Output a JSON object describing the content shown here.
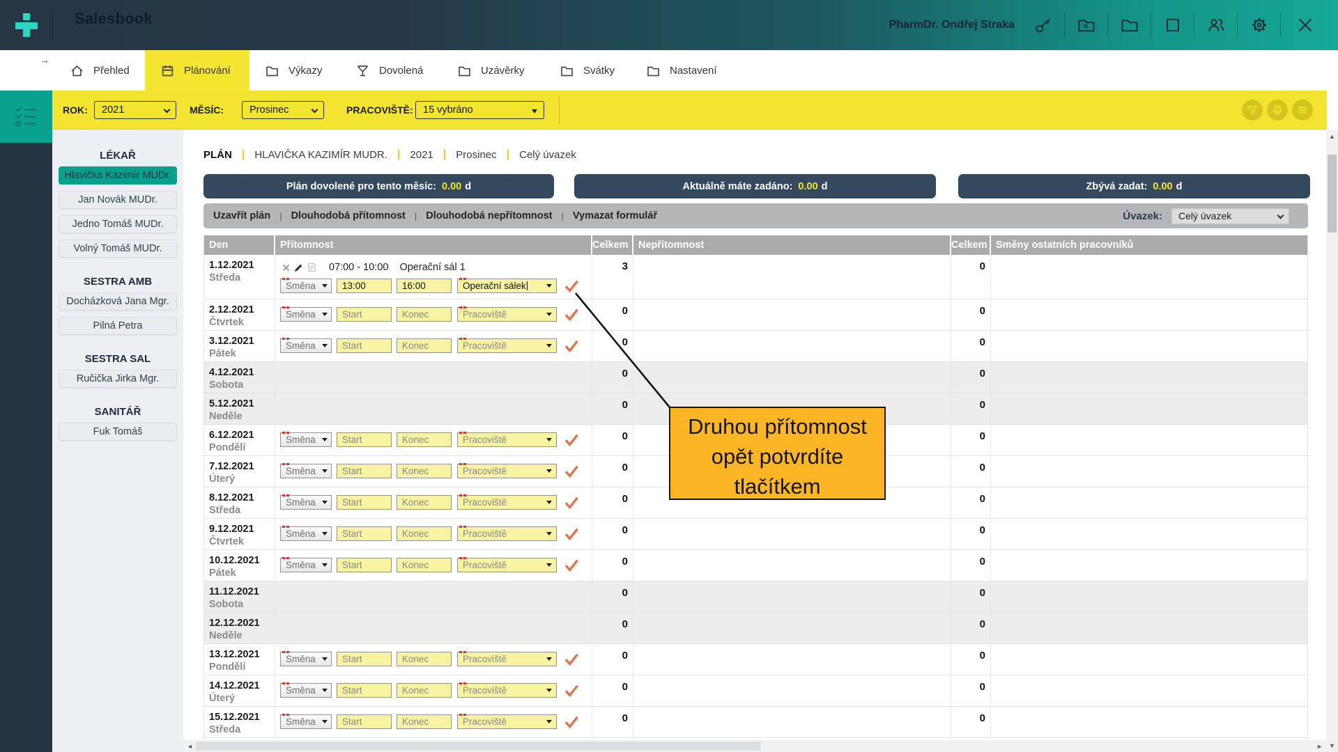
{
  "colors": {
    "brand_teal": "#0AA28E",
    "header_navy": "#273645",
    "header_teal": "#17A897",
    "accent_yellow": "#F3E42F",
    "pill_navy": "#35495E",
    "pill_value_yellow": "#F7E327",
    "check_orange": "#DF744A",
    "callout_amber": "#FBB525",
    "field_yellow": "#F8F2A3",
    "required_red": "#E33528"
  },
  "header": {
    "app_title": "Salesbook",
    "user_name": "PharmDr. Ondřej Straka",
    "icons": [
      "key-icon",
      "folder-n-icon",
      "folder-icon",
      "window-restore-icon",
      "users-icon",
      "gear-icon",
      "close-icon"
    ]
  },
  "nav": {
    "back_arrow": "→",
    "tabs": [
      {
        "label": "Přehled",
        "icon": "home-icon",
        "active": false
      },
      {
        "label": "Plánování",
        "icon": "calendar-icon",
        "active": true
      },
      {
        "label": "Výkazy",
        "icon": "folder-icon",
        "active": false
      },
      {
        "label": "Dovolená",
        "icon": "cocktail-icon",
        "active": false
      },
      {
        "label": "Uzávěrky",
        "icon": "folder-icon",
        "active": false
      },
      {
        "label": "Svátky",
        "icon": "folder-icon",
        "active": false
      },
      {
        "label": "Nastavení",
        "icon": "folder-icon",
        "active": false
      }
    ]
  },
  "filter_bar": {
    "year_label": "ROK:",
    "year_value": "2021",
    "month_label": "MĚSÍC:",
    "month_value": "Prosinec",
    "workplace_label": "PRACOVIŠTĚ:",
    "workplace_value": "15 vybráno",
    "actions": [
      "filter-icon",
      "print-icon",
      "menu-icon"
    ]
  },
  "sidebar": {
    "groups": [
      {
        "title": "LÉKAŘ",
        "items": [
          {
            "label": "Hlavička Kazimír MUDr.",
            "selected": true
          },
          {
            "label": "Jan Novák MUDr.",
            "selected": false
          },
          {
            "label": "Jedno Tomáš MUDr.",
            "selected": false
          },
          {
            "label": "Volný Tomáš MUDr.",
            "selected": false
          }
        ]
      },
      {
        "title": "SESTRA AMB",
        "items": [
          {
            "label": "Docházková Jana Mgr.",
            "selected": false
          },
          {
            "label": "Pilná Petra",
            "selected": false
          }
        ]
      },
      {
        "title": "SESTRA SAL",
        "items": [
          {
            "label": "Ručička Jirka Mgr.",
            "selected": false
          }
        ]
      },
      {
        "title": "SANITÁŘ",
        "items": [
          {
            "label": "Fuk Tomáš",
            "selected": false
          }
        ]
      }
    ]
  },
  "main": {
    "breadcrumb": {
      "root": "PLÁN",
      "separator": "|",
      "items": [
        "HLAVIČKA KAZIMÍR MUDR.",
        "2021",
        "Prosinec",
        "Celý úvazek"
      ]
    },
    "summary_pills": [
      {
        "label": "Plán dovolené pro tento měsíc:",
        "value": "0.00",
        "unit": "d"
      },
      {
        "label": "Aktuálně máte zadáno:",
        "value": "0.00",
        "unit": "d"
      },
      {
        "label": "Zbývá zadat:",
        "value": "0.00",
        "unit": "d"
      }
    ],
    "toolbar": {
      "links": [
        "Uzavřít plán",
        "Dlouhodobá přítomnost",
        "Dlouhodobá nepřítomnost",
        "Vymazat formulář"
      ],
      "separator": "|",
      "contract_label": "Úvazek:",
      "contract_value": "Celý úvazek"
    },
    "table": {
      "columns": [
        "Den",
        "Přítomnost",
        "Celkem",
        "Nepřítomnost",
        "Celkem",
        "Směny ostatních pracovníků"
      ],
      "rows": [
        {
          "date": "1.12.2021",
          "day": "Středa",
          "total_presence": "3",
          "total_absence": "0",
          "entry": {
            "time": "07:00 - 10:00",
            "place": "Operační sál 1"
          },
          "form": {
            "shift": "Směna",
            "start": "13:00",
            "end": "16:00",
            "workplace": "Operační sálek",
            "filled": true
          }
        },
        {
          "date": "2.12.2021",
          "day": "Čtvrtek",
          "total_presence": "0",
          "total_absence": "0",
          "form": {
            "shift": "Směna",
            "start": "Start",
            "end": "Konec",
            "workplace": "Pracoviště",
            "filled": false
          }
        },
        {
          "date": "3.12.2021",
          "day": "Pátek",
          "total_presence": "0",
          "total_absence": "0",
          "form": {
            "shift": "Směna",
            "start": "Start",
            "end": "Konec",
            "workplace": "Pracoviště",
            "filled": false
          }
        },
        {
          "date": "4.12.2021",
          "day": "Sobota",
          "weekend": true,
          "total_presence": "0",
          "total_absence": "0"
        },
        {
          "date": "5.12.2021",
          "day": "Neděle",
          "weekend": true,
          "total_presence": "0",
          "total_absence": "0"
        },
        {
          "date": "6.12.2021",
          "day": "Pondělí",
          "total_presence": "0",
          "total_absence": "0",
          "form": {
            "shift": "Směna",
            "start": "Start",
            "end": "Konec",
            "workplace": "Pracoviště",
            "filled": false
          }
        },
        {
          "date": "7.12.2021",
          "day": "Úterý",
          "total_presence": "0",
          "total_absence": "0",
          "form": {
            "shift": "Směna",
            "start": "Start",
            "end": "Konec",
            "workplace": "Pracoviště",
            "filled": false
          }
        },
        {
          "date": "8.12.2021",
          "day": "Středa",
          "total_presence": "0",
          "total_absence": "0",
          "form": {
            "shift": "Směna",
            "start": "Start",
            "end": "Konec",
            "workplace": "Pracoviště",
            "filled": false
          }
        },
        {
          "date": "9.12.2021",
          "day": "Čtvrtek",
          "total_presence": "0",
          "total_absence": "0",
          "form": {
            "shift": "Směna",
            "start": "Start",
            "end": "Konec",
            "workplace": "Pracoviště",
            "filled": false
          }
        },
        {
          "date": "10.12.2021",
          "day": "Pátek",
          "total_presence": "0",
          "total_absence": "0",
          "form": {
            "shift": "Směna",
            "start": "Start",
            "end": "Konec",
            "workplace": "Pracoviště",
            "filled": false
          }
        },
        {
          "date": "11.12.2021",
          "day": "Sobota",
          "weekend": true,
          "total_presence": "0",
          "total_absence": "0"
        },
        {
          "date": "12.12.2021",
          "day": "Neděle",
          "weekend": true,
          "total_presence": "0",
          "total_absence": "0"
        },
        {
          "date": "13.12.2021",
          "day": "Pondělí",
          "total_presence": "0",
          "total_absence": "0",
          "form": {
            "shift": "Směna",
            "start": "Start",
            "end": "Konec",
            "workplace": "Pracoviště",
            "filled": false
          }
        },
        {
          "date": "14.12.2021",
          "day": "Úterý",
          "total_presence": "0",
          "total_absence": "0",
          "form": {
            "shift": "Směna",
            "start": "Start",
            "end": "Konec",
            "workplace": "Pracoviště",
            "filled": false
          }
        },
        {
          "date": "15.12.2021",
          "day": "Středa",
          "total_presence": "0",
          "total_absence": "0",
          "form": {
            "shift": "Směna",
            "start": "Start",
            "end": "Konec",
            "workplace": "Pracoviště",
            "filled": false
          }
        }
      ]
    },
    "callout": {
      "lines": [
        "Druhou přítomnost",
        "opět potvrdíte",
        "tlačítkem"
      ]
    }
  }
}
